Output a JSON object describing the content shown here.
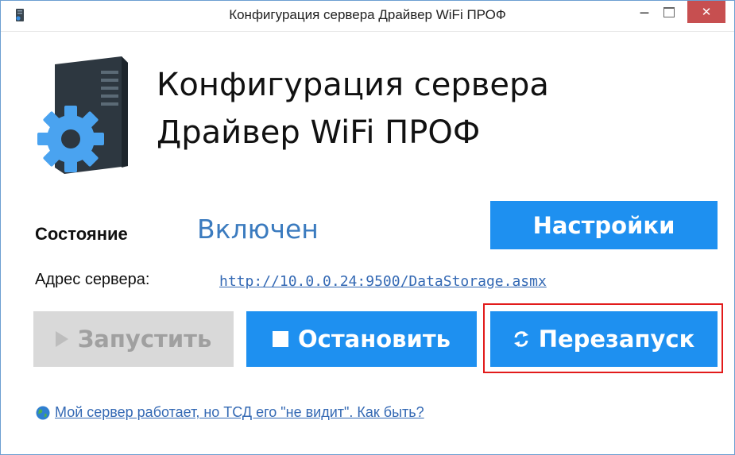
{
  "window": {
    "title": "Конфигурация сервера Драйвер WiFi ПРОФ",
    "controls": {
      "minimize": "‒",
      "close": "✕"
    }
  },
  "header": {
    "title_line1": "Конфигурация сервера",
    "title_line2": "Драйвер WiFi ПРОФ"
  },
  "status": {
    "label": "Состояние",
    "value": "Включен"
  },
  "buttons": {
    "settings": "Настройки",
    "start": "Запустить",
    "stop": "Остановить",
    "restart": "Перезапуск"
  },
  "server": {
    "address_label": "Адрес сервера:",
    "address_url": "http://10.0.0.24:9500/DataStorage.asmx"
  },
  "help": {
    "link_text": "Мой сервер работает, но ТСД его \"не видит\". Как быть?"
  },
  "colors": {
    "accent": "#1e90f0",
    "status_value": "#3b7bbf",
    "link": "#3469b4",
    "disabled_bg": "#d9d9d9",
    "highlight": "#e21b1b",
    "close_button": "#c74f50"
  },
  "icons": {
    "app": "app-icon",
    "logo": "server-gear-icon",
    "start": "play-icon",
    "stop": "stop-icon",
    "restart": "refresh-icon",
    "help": "globe-icon"
  }
}
